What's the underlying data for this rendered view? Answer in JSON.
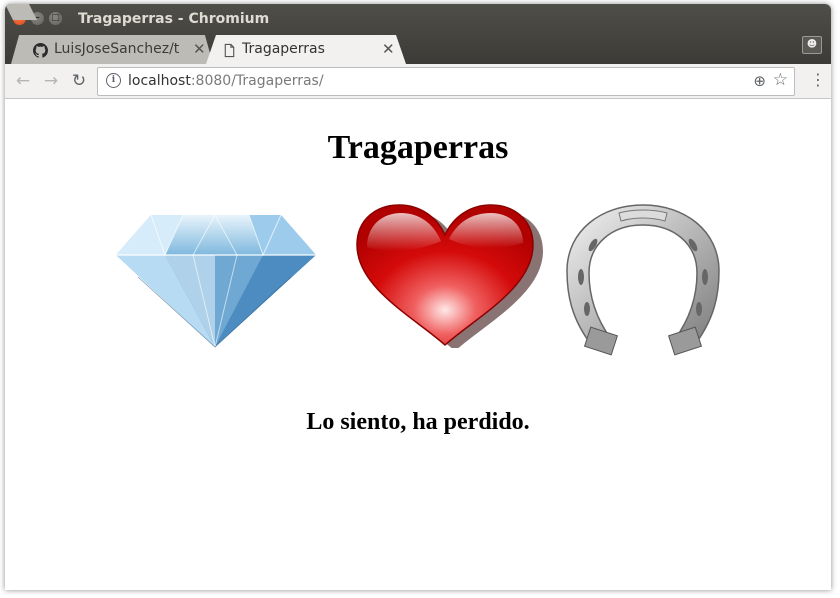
{
  "window": {
    "title": "Tragaperras - Chromium",
    "controls": {
      "close": "✕",
      "minimize": "–",
      "maximize": "□"
    }
  },
  "tabs": [
    {
      "label": "LuisJoseSanchez/t",
      "icon": "github-icon",
      "close": "✕"
    },
    {
      "label": "Tragaperras",
      "icon": "page-icon",
      "close": "✕"
    }
  ],
  "toolbar": {
    "back": "←",
    "forward": "→",
    "reload": "↻",
    "url_host": "localhost",
    "url_rest": ":8080/Tragaperras/",
    "zoom": "⊕",
    "bookmark": "☆",
    "menu": "⋮"
  },
  "page": {
    "title": "Tragaperras",
    "slots": [
      "diamond",
      "heart",
      "horseshoe"
    ],
    "result": "Lo siento, ha perdido."
  }
}
